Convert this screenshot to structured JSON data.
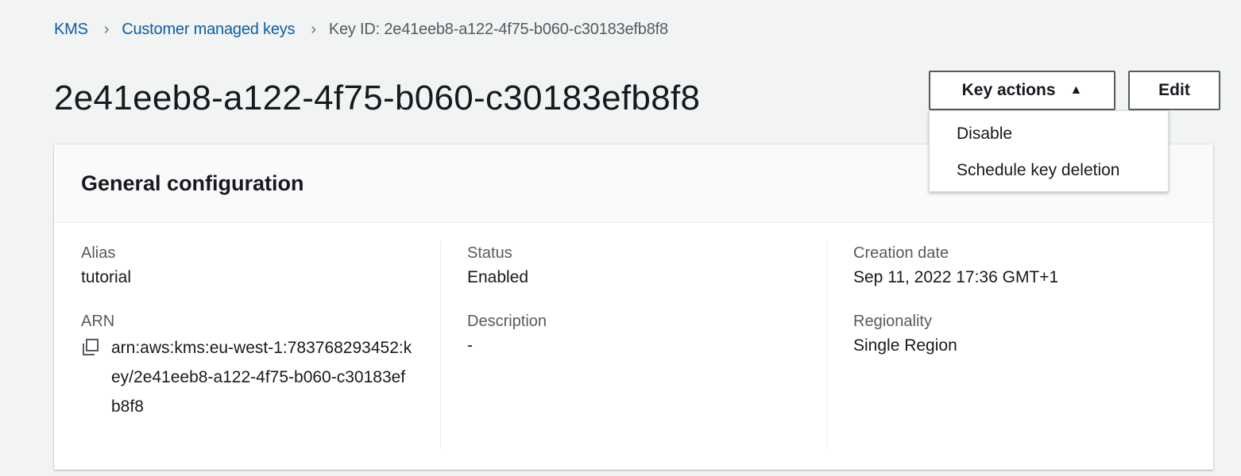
{
  "breadcrumb": {
    "items": [
      {
        "label": "KMS"
      },
      {
        "label": "Customer managed keys"
      }
    ],
    "current": "Key ID: 2e41eeb8-a122-4f75-b060-c30183efb8f8"
  },
  "header": {
    "title": "2e41eeb8-a122-4f75-b060-c30183efb8f8",
    "key_actions_label": "Key actions",
    "edit_label": "Edit"
  },
  "key_actions_menu": {
    "items": [
      {
        "label": "Disable"
      },
      {
        "label": "Schedule key deletion"
      }
    ]
  },
  "general_configuration": {
    "title": "General configuration",
    "alias": {
      "label": "Alias",
      "value": "tutorial"
    },
    "arn": {
      "label": "ARN",
      "value": "arn:aws:kms:eu-west-1:783768293452:key/2e41eeb8-a122-4f75-b060-c30183efb8f8"
    },
    "status": {
      "label": "Status",
      "value": "Enabled"
    },
    "description": {
      "label": "Description",
      "value": "-"
    },
    "creation_date": {
      "label": "Creation date",
      "value": "Sep 11, 2022 17:36 GMT+1"
    },
    "regionality": {
      "label": "Regionality",
      "value": "Single Region"
    }
  },
  "icons": {
    "breadcrumb_separator": "chevron-right-icon",
    "caret": "caret-up-icon",
    "copy": "copy-icon"
  },
  "colors": {
    "link": "#0b5ea8",
    "background": "#f2f3f3",
    "text": "#16191f",
    "muted": "#545b64"
  }
}
